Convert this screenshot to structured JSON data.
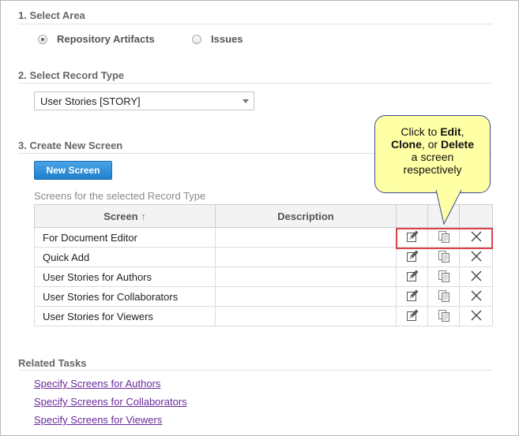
{
  "sections": {
    "select_area": "1. Select Area",
    "select_record_type": "2. Select Record Type",
    "create_new_screen": "3. Create New Screen",
    "related_tasks": "Related Tasks"
  },
  "area": {
    "options": [
      "Repository Artifacts",
      "Issues"
    ],
    "selected": "Repository Artifacts"
  },
  "record_type": {
    "selected": "User Stories [STORY]"
  },
  "new_screen_button": "New Screen",
  "screens_caption": "Screens for the selected Record Type",
  "table": {
    "headers": {
      "screen": "Screen",
      "sort_glyph": "↑",
      "description": "Description"
    },
    "rows": [
      {
        "screen": "For Document Editor",
        "description": ""
      },
      {
        "screen": "Quick Add",
        "description": ""
      },
      {
        "screen": "User Stories for Authors",
        "description": ""
      },
      {
        "screen": "User Stories for Collaborators",
        "description": ""
      },
      {
        "screen": "User Stories for Viewers",
        "description": ""
      }
    ],
    "action_icons": [
      "edit-icon",
      "clone-icon",
      "delete-icon"
    ]
  },
  "callout": {
    "line1_pre": "Click to ",
    "edit": "Edit",
    "comma1": ",",
    "clone": "Clone",
    "or": ", or ",
    "delete": "Delete",
    "line3": "a screen",
    "line4": "respectively"
  },
  "related_links": [
    "Specify Screens for Authors",
    "Specify Screens for Collaborators",
    "Specify Screens for Viewers"
  ],
  "colors": {
    "link": "#6a2a9b",
    "button": "#2a8ad8",
    "highlight_border": "#d9434a",
    "callout_fill": "#ffffa6"
  }
}
